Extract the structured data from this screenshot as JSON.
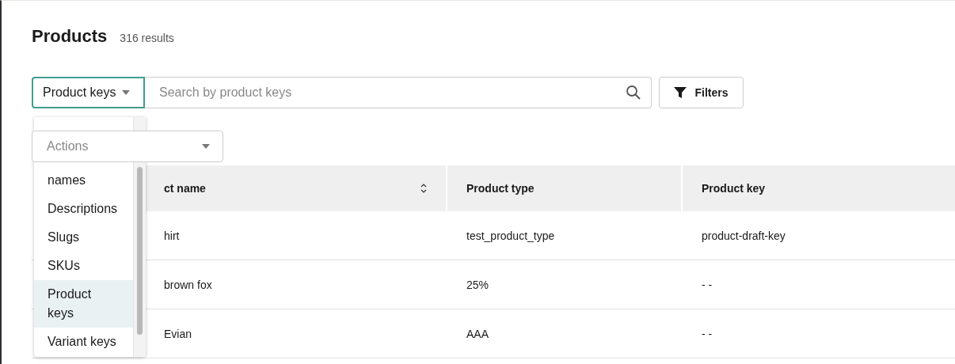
{
  "page": {
    "title": "Products",
    "result_count": "316 results"
  },
  "search": {
    "scope": "Product keys",
    "placeholder": "Search by product keys",
    "filters_button": "Filters"
  },
  "scope_menu": {
    "items": [
      {
        "label": "names",
        "selected": false
      },
      {
        "label": "Descriptions",
        "selected": false
      },
      {
        "label": "Slugs",
        "selected": false
      },
      {
        "label": "SKUs",
        "selected": false
      },
      {
        "label": "Product keys",
        "selected": true
      },
      {
        "label": "Variant keys",
        "selected": false
      }
    ]
  },
  "actions": {
    "placeholder": "Actions"
  },
  "table": {
    "columns": [
      {
        "label": "ct name",
        "sortable": true
      },
      {
        "label": "Product type",
        "sortable": false
      },
      {
        "label": "Product key",
        "sortable": false
      }
    ],
    "rows": [
      [
        "hirt",
        "test_product_type",
        "product-draft-key"
      ],
      [
        "brown fox",
        "25%",
        "- -"
      ],
      [
        "Evian",
        "AAA",
        "- -"
      ]
    ]
  }
}
